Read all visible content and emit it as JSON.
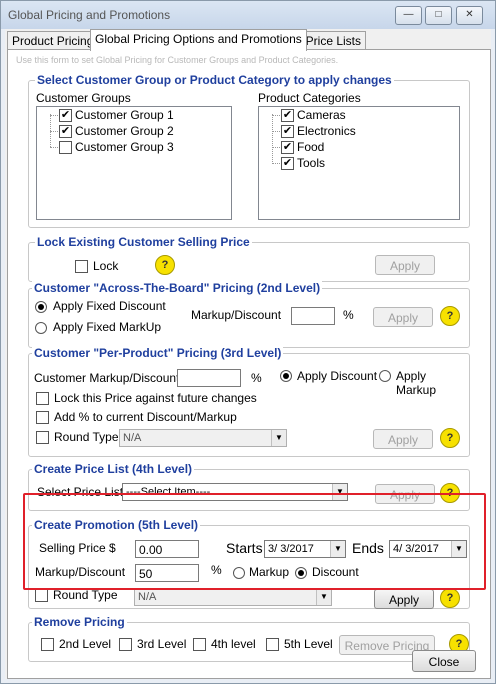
{
  "window": {
    "title": "Global Pricing and Promotions",
    "minimize": "—",
    "maximize": "□",
    "close": "✕"
  },
  "tabs": [
    {
      "label": "Product Pricing"
    },
    {
      "label": "Global Pricing Options and Promotions"
    },
    {
      "label": "All Price Lists"
    }
  ],
  "hint": "Use this form to set Global Pricing for Customer Groups and Product Categories.",
  "select_group": {
    "title": "Select Customer Group or Product Category to apply changes",
    "groups_label": "Customer Groups",
    "groups": [
      "Customer Group 1",
      "Customer Group 2",
      "Customer Group 3"
    ],
    "categories_label": "Product Categories",
    "categories": [
      "Cameras",
      "Electronics",
      "Food",
      "Tools"
    ]
  },
  "lock": {
    "title": "Lock Existing Customer Selling Price",
    "lock_label": "Lock",
    "apply": "Apply"
  },
  "level2": {
    "title": "Customer \"Across-The-Board\" Pricing (2nd Level)",
    "fixed_discount": "Apply Fixed Discount",
    "fixed_markup": "Apply Fixed MarkUp",
    "markup_label": "Markup/Discount",
    "pct": "%",
    "apply": "Apply"
  },
  "level3": {
    "title": "Customer \"Per-Product\" Pricing (3rd Level)",
    "markup_label": "Customer Markup/Discount",
    "pct": "%",
    "apply_discount": "Apply Discount",
    "apply_markup": "Apply Markup",
    "lock_future": "Lock this Price against future changes",
    "add_pct": "Add % to current Discount/Markup",
    "round_type": "Round Type",
    "round_value": "N/A",
    "apply": "Apply"
  },
  "level4": {
    "title": "Create Price List (4th Level)",
    "select_label": "Select Price List",
    "select_value": "----Select Item----",
    "apply": "Apply"
  },
  "level5": {
    "title": "Create Promotion (5th Level)",
    "selling_price_label": "Selling Price $",
    "selling_price": "0.00",
    "starts_label": "Starts",
    "starts": "3/ 3/2017",
    "ends_label": "Ends",
    "ends": "4/ 3/2017",
    "markup_label": "Markup/Discount",
    "markup_value": "50",
    "pct": "%",
    "markup_opt": "Markup",
    "discount_opt": "Discount",
    "round_type": "Round Type",
    "round_value": "N/A",
    "apply": "Apply"
  },
  "remove": {
    "title": "Remove Pricing",
    "opt2": "2nd Level",
    "opt3": "3rd Level",
    "opt4": "4th level",
    "opt5": "5th Level",
    "button": "Remove Pricing"
  },
  "close_button": "Close",
  "help": "?",
  "check": "✔",
  "dropdown": "▼"
}
